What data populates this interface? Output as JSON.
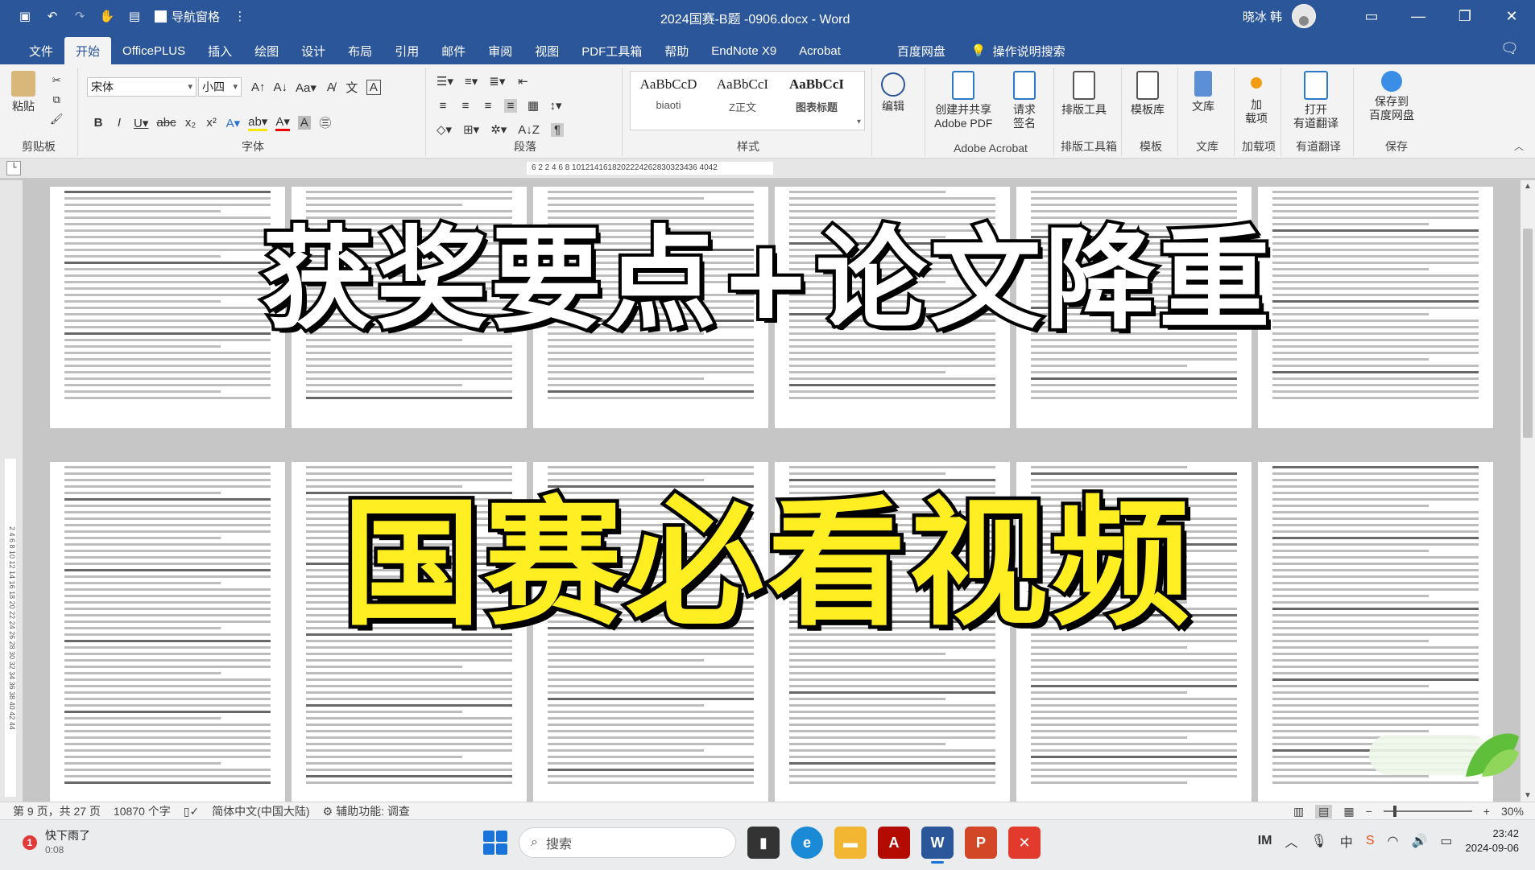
{
  "window": {
    "doc_title": "2024国赛-B题 -0906.docx - Word",
    "nav_pane_label": "导航窗格",
    "user_name": "晓冰 韩"
  },
  "tabs": [
    {
      "label": "文件"
    },
    {
      "label": "开始",
      "active": true
    },
    {
      "label": "OfficePLUS"
    },
    {
      "label": "插入"
    },
    {
      "label": "绘图"
    },
    {
      "label": "设计"
    },
    {
      "label": "布局"
    },
    {
      "label": "引用"
    },
    {
      "label": "邮件"
    },
    {
      "label": "审阅"
    },
    {
      "label": "视图"
    },
    {
      "label": "PDF工具箱"
    },
    {
      "label": "帮助"
    },
    {
      "label": "EndNote X9"
    },
    {
      "label": "Acrobat"
    },
    {
      "label": "百度网盘"
    }
  ],
  "tell_me": "操作说明搜索",
  "ribbon": {
    "clipboard": {
      "paste": "粘贴",
      "group": "剪贴板"
    },
    "font": {
      "name": "宋体",
      "size": "小四",
      "group": "字体"
    },
    "paragraph": {
      "group": "段落"
    },
    "styles": {
      "group": "样式",
      "items": [
        {
          "sample": "AaBbCcD",
          "name": "biaoti"
        },
        {
          "sample": "AaBbCcI",
          "name": "Z正文"
        },
        {
          "sample": "AaBbCcI",
          "name": "图表标题"
        }
      ]
    },
    "editing": {
      "label": "编辑"
    },
    "adobe": {
      "create_share": "创建并共享",
      "create_share2": "Adobe PDF",
      "request": "请求",
      "request2": "签名",
      "group": "Adobe Acrobat"
    },
    "layout_tool": {
      "label": "排版工具",
      "group": "排版工具箱"
    },
    "template": {
      "label": "模板库",
      "group": "模板"
    },
    "library": {
      "label": "文库",
      "group": "文库"
    },
    "addin": {
      "label": "加",
      "label2": "载项",
      "group": "加载项"
    },
    "translate": {
      "label": "打开",
      "label2": "有道翻译",
      "group": "有道翻译"
    },
    "save_baidu": {
      "label": "保存到",
      "label2": "百度网盘",
      "group": "保存"
    }
  },
  "ruler_text": "6  2  2 4 6 8 1012141618202224262830323436  4042",
  "overlay": {
    "line1": "获奖要点+论文降重",
    "line2": "国赛必看视频"
  },
  "status": {
    "page": "第 9 页，共 27 页",
    "words": "10870 个字",
    "language": "简体中文(中国大陆)",
    "accessibility": "辅助功能: 调查",
    "zoom": "30%"
  },
  "taskbar": {
    "weather_title": "快下雨了",
    "weather_sub": "0:08",
    "weather_badge": "1",
    "search_placeholder": "搜索",
    "time": "23:42",
    "date": "2024-09-06",
    "ime": "中"
  },
  "colors": {
    "word_blue": "#2b579a",
    "headline_white": "#ffffff",
    "headline_yellow": "#ffee22"
  }
}
